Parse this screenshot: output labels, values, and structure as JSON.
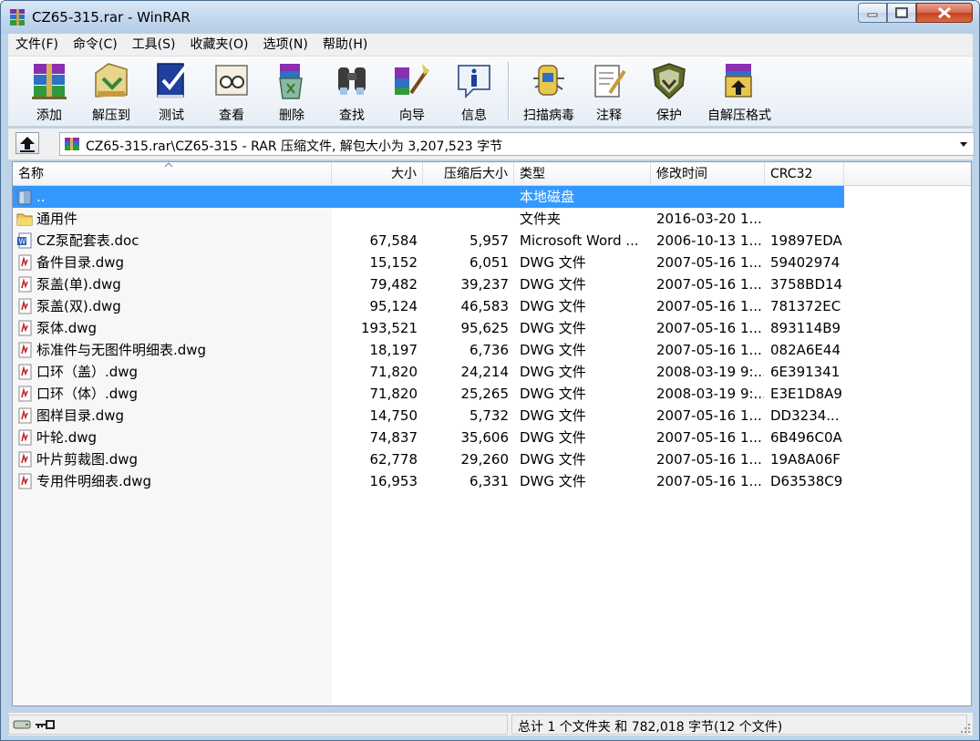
{
  "window": {
    "title": "CZ65-315.rar - WinRAR",
    "colors": {
      "selection": "#3399ff",
      "titlebar": "#c4d8ee",
      "close": "#c7401d"
    }
  },
  "menu": [
    "文件(F)",
    "命令(C)",
    "工具(S)",
    "收藏夹(O)",
    "选项(N)",
    "帮助(H)"
  ],
  "toolbar": [
    {
      "label": "添加",
      "icon": "add-archive-icon"
    },
    {
      "label": "解压到",
      "icon": "extract-to-icon"
    },
    {
      "label": "测试",
      "icon": "test-icon"
    },
    {
      "label": "查看",
      "icon": "view-icon"
    },
    {
      "label": "删除",
      "icon": "delete-icon"
    },
    {
      "label": "查找",
      "icon": "find-icon"
    },
    {
      "label": "向导",
      "icon": "wizard-icon"
    },
    {
      "label": "信息",
      "icon": "info-icon"
    },
    {
      "label": "扫描病毒",
      "icon": "virus-scan-icon"
    },
    {
      "label": "注释",
      "icon": "comment-icon"
    },
    {
      "label": "保护",
      "icon": "protect-icon"
    },
    {
      "label": "自解压格式",
      "icon": "sfx-icon"
    }
  ],
  "address": {
    "path": "CZ65-315.rar\\CZ65-315 - RAR 压缩文件, 解包大小为 3,207,523 字节"
  },
  "columns": {
    "name": "名称",
    "size": "大小",
    "packed": "压缩后大小",
    "type": "类型",
    "modified": "修改时间",
    "crc": "CRC32"
  },
  "files": [
    {
      "name": "..",
      "size": "",
      "packed": "",
      "type": "本地磁盘",
      "modified": "",
      "crc": "",
      "icon": "parent-folder-icon",
      "selected": true
    },
    {
      "name": "通用件",
      "size": "",
      "packed": "",
      "type": "文件夹",
      "modified": "2016-03-20 1...",
      "crc": "",
      "icon": "folder-icon"
    },
    {
      "name": "CZ泵配套表.doc",
      "size": "67,584",
      "packed": "5,957",
      "type": "Microsoft Word ...",
      "modified": "2006-10-13 1...",
      "crc": "19897EDA",
      "icon": "word-doc-icon"
    },
    {
      "name": "备件目录.dwg",
      "size": "15,152",
      "packed": "6,051",
      "type": "DWG 文件",
      "modified": "2007-05-16 1...",
      "crc": "59402974",
      "icon": "dwg-file-icon"
    },
    {
      "name": "泵盖(单).dwg",
      "size": "79,482",
      "packed": "39,237",
      "type": "DWG 文件",
      "modified": "2007-05-16 1...",
      "crc": "3758BD14",
      "icon": "dwg-file-icon"
    },
    {
      "name": "泵盖(双).dwg",
      "size": "95,124",
      "packed": "46,583",
      "type": "DWG 文件",
      "modified": "2007-05-16 1...",
      "crc": "781372EC",
      "icon": "dwg-file-icon"
    },
    {
      "name": "泵体.dwg",
      "size": "193,521",
      "packed": "95,625",
      "type": "DWG 文件",
      "modified": "2007-05-16 1...",
      "crc": "893114B9",
      "icon": "dwg-file-icon"
    },
    {
      "name": "标准件与无图件明细表.dwg",
      "size": "18,197",
      "packed": "6,736",
      "type": "DWG 文件",
      "modified": "2007-05-16 1...",
      "crc": "082A6E44",
      "icon": "dwg-file-icon"
    },
    {
      "name": "口环（盖）.dwg",
      "size": "71,820",
      "packed": "24,214",
      "type": "DWG 文件",
      "modified": "2008-03-19 9:...",
      "crc": "6E391341",
      "icon": "dwg-file-icon"
    },
    {
      "name": "口环（体）.dwg",
      "size": "71,820",
      "packed": "25,265",
      "type": "DWG 文件",
      "modified": "2008-03-19 9:...",
      "crc": "E3E1D8A9",
      "icon": "dwg-file-icon"
    },
    {
      "name": "图样目录.dwg",
      "size": "14,750",
      "packed": "5,732",
      "type": "DWG 文件",
      "modified": "2007-05-16 1...",
      "crc": "DD3234...",
      "icon": "dwg-file-icon"
    },
    {
      "name": "叶轮.dwg",
      "size": "74,837",
      "packed": "35,606",
      "type": "DWG 文件",
      "modified": "2007-05-16 1...",
      "crc": "6B496C0A",
      "icon": "dwg-file-icon"
    },
    {
      "name": "叶片剪裁图.dwg",
      "size": "62,778",
      "packed": "29,260",
      "type": "DWG 文件",
      "modified": "2007-05-16 1...",
      "crc": "19A8A06F",
      "icon": "dwg-file-icon"
    },
    {
      "name": "专用件明细表.dwg",
      "size": "16,953",
      "packed": "6,331",
      "type": "DWG 文件",
      "modified": "2007-05-16 1...",
      "crc": "D63538C9",
      "icon": "dwg-file-icon"
    }
  ],
  "status": {
    "summary": "总计 1 个文件夹 和 782,018 字节(12 个文件)"
  }
}
